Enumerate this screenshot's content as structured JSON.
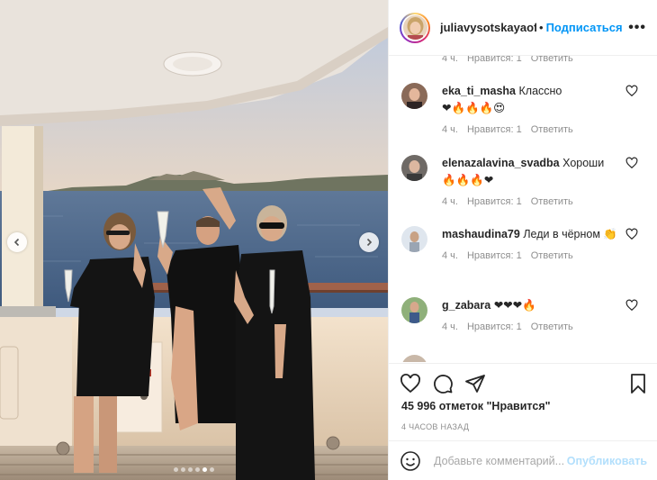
{
  "header": {
    "username": "juliavysotskayaofficial",
    "separator": "•",
    "follow_label": "Подписаться",
    "more_label": "•••"
  },
  "top_meta": {
    "time": "4 ч.",
    "likes": "Нравится: 1",
    "reply": "Ответить"
  },
  "comments": [
    {
      "user": "eka_ti_masha",
      "text": "Классно",
      "emoji": "❤🔥🔥🔥😍",
      "time": "4 ч.",
      "likes": "Нравится: 1",
      "reply": "Ответить"
    },
    {
      "user": "elenazalavina_svadba",
      "text": "Хороши",
      "emoji": "🔥🔥🔥❤",
      "time": "4 ч.",
      "likes": "Нравится: 1",
      "reply": "Ответить"
    },
    {
      "user": "mashaudina79",
      "text": "Леди в чёрном",
      "emoji": "👏",
      "time": "4 ч.",
      "likes": "Нравится: 1",
      "reply": "Ответить"
    },
    {
      "user": "g_zabara",
      "text": "",
      "emoji": "❤❤❤🔥",
      "time": "4 ч.",
      "likes": "Нравится: 1",
      "reply": "Ответить"
    }
  ],
  "likes_text": "45 996 отметок \"Нравится\"",
  "time_ago": "4 ЧАСОВ НАЗАД",
  "add_comment": {
    "placeholder": "Добавьте комментарий...",
    "post_label": "Опубликовать"
  },
  "carousel": {
    "total": 6,
    "active": 5
  },
  "colors": {
    "link": "#0095f6",
    "meta": "#8e8e8e",
    "post_disabled": "#b2dffc"
  }
}
